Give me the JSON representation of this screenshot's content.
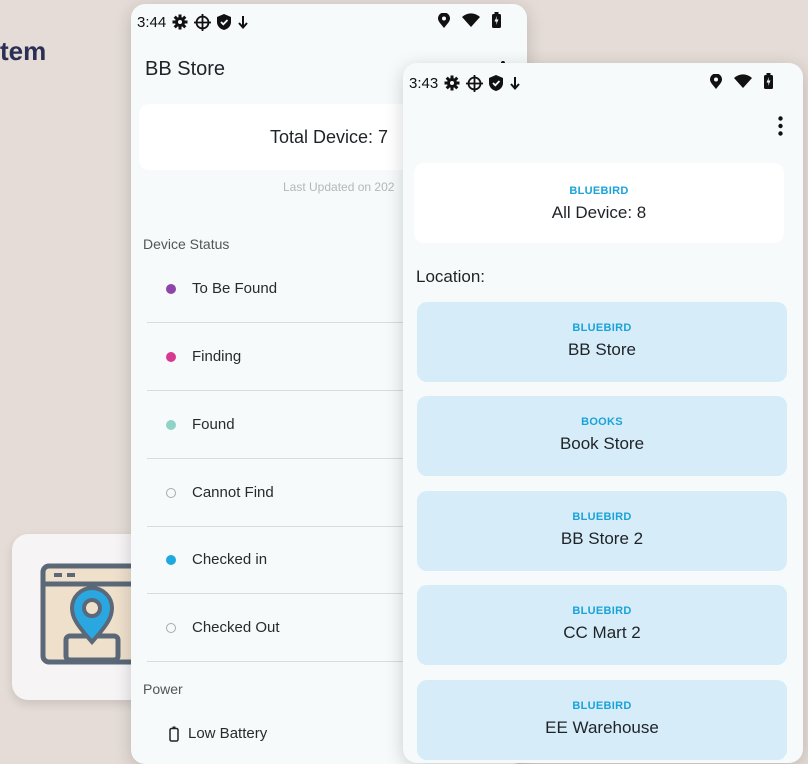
{
  "background": {
    "title_fragment": "tem"
  },
  "back_phone": {
    "status_time": "3:44",
    "title": "BB Store",
    "total_device": "Total Device: 7",
    "last_updated": "Last Updated on 202",
    "device_status_label": "Device Status",
    "statuses": [
      {
        "label": "To Be Found",
        "color": "#8e44a8",
        "hollow": false
      },
      {
        "label": "Finding",
        "color": "#d63a8e",
        "hollow": false
      },
      {
        "label": "Found",
        "color": "#8fd3c7",
        "hollow": false
      },
      {
        "label": "Cannot Find",
        "color": "",
        "hollow": true
      },
      {
        "label": "Checked in",
        "color": "#1fa9df",
        "hollow": false
      },
      {
        "label": "Checked Out",
        "color": "",
        "hollow": true
      }
    ],
    "power_label": "Power",
    "power_items": [
      {
        "label": "Low Battery",
        "icon": "battery-icon"
      }
    ]
  },
  "front_phone": {
    "status_time": "3:43",
    "all_device": {
      "tag": "BLUEBIRD",
      "label": "All Device: 8"
    },
    "location_heading": "Location:",
    "locations": [
      {
        "tag": "BLUEBIRD",
        "name": "BB Store"
      },
      {
        "tag": "BOOKS",
        "name": "Book Store"
      },
      {
        "tag": "BLUEBIRD",
        "name": "BB Store 2"
      },
      {
        "tag": "BLUEBIRD",
        "name": "CC Mart 2"
      },
      {
        "tag": "BLUEBIRD",
        "name": "EE Warehouse"
      }
    ]
  },
  "colors": {
    "accent": "#1aa3d8",
    "card_blue": "#d6ecf8",
    "page_bg": "#e5dcd7"
  }
}
